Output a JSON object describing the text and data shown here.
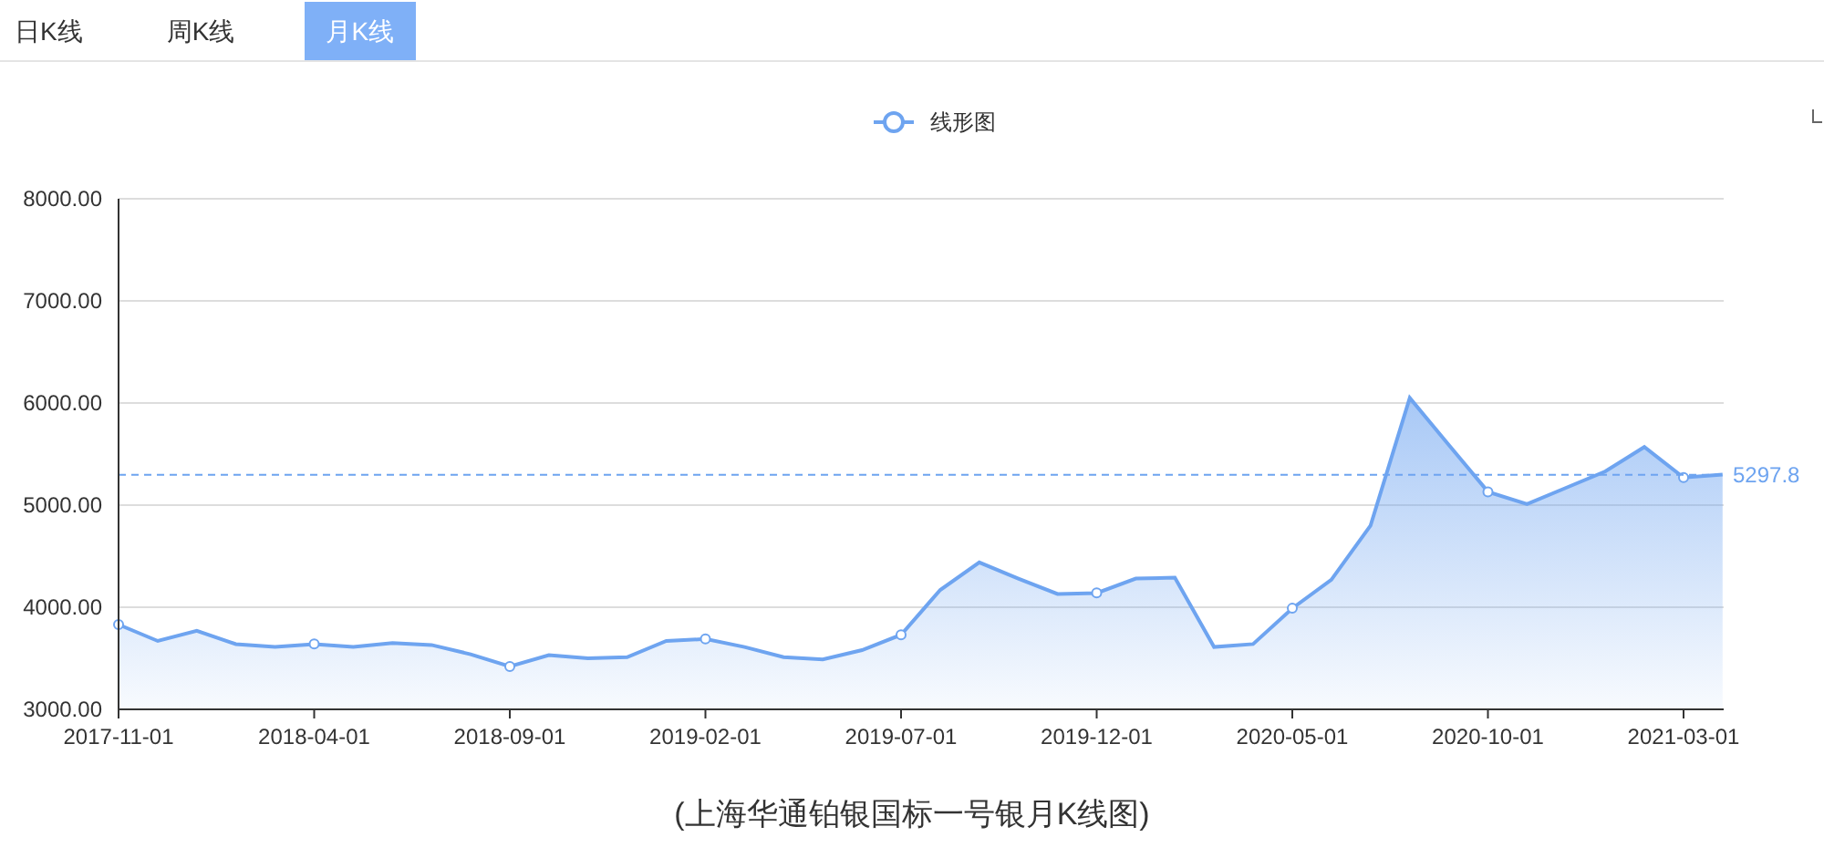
{
  "tabs": [
    {
      "label": "日K线",
      "selected": false
    },
    {
      "label": "周K线",
      "selected": false
    },
    {
      "label": "月K线",
      "selected": true
    }
  ],
  "chart": {
    "chart_data": {
      "type": "area",
      "categories": [
        "2017-11-01",
        null,
        null,
        null,
        null,
        "2018-04-01",
        null,
        null,
        null,
        null,
        "2018-09-01",
        null,
        null,
        null,
        null,
        "2019-02-01",
        null,
        null,
        null,
        null,
        "2019-07-01",
        null,
        null,
        null,
        null,
        "2019-12-01",
        null,
        null,
        null,
        null,
        "2020-05-01",
        null,
        null,
        null,
        null,
        "2020-10-01",
        null,
        null,
        null,
        null,
        "2021-03-01",
        null
      ],
      "series": [
        {
          "name": "线形图",
          "color": "#6ea4f0",
          "values": [
            3830,
            3670,
            3770,
            3640,
            3610,
            3640,
            3610,
            3650,
            3630,
            3540,
            3420,
            3530,
            3500,
            3510,
            3670,
            3690,
            3610,
            3510,
            3490,
            3580,
            3730,
            4170,
            4440,
            4280,
            4130,
            4140,
            4280,
            4290,
            3610,
            3640,
            3990,
            4270,
            4800,
            6050,
            5590,
            5130,
            5010,
            5170,
            5330,
            5570,
            5270,
            5297.8
          ]
        }
      ],
      "ylim": [
        3000,
        8000
      ],
      "yticks": [
        {
          "value": 3000,
          "label": "3000.00"
        },
        {
          "value": 4000,
          "label": "4000.00"
        },
        {
          "value": 5000,
          "label": "5000.00"
        },
        {
          "value": 6000,
          "label": "6000.00"
        },
        {
          "value": 7000,
          "label": "7000.00"
        },
        {
          "value": 8000,
          "label": "8000.00"
        }
      ],
      "grid": true,
      "ref_lines": [
        {
          "axis": "y",
          "value": 5297.8,
          "label": "5297.8"
        }
      ]
    }
  },
  "caption": "(上海华通铂银国标一号银月K线图)"
}
